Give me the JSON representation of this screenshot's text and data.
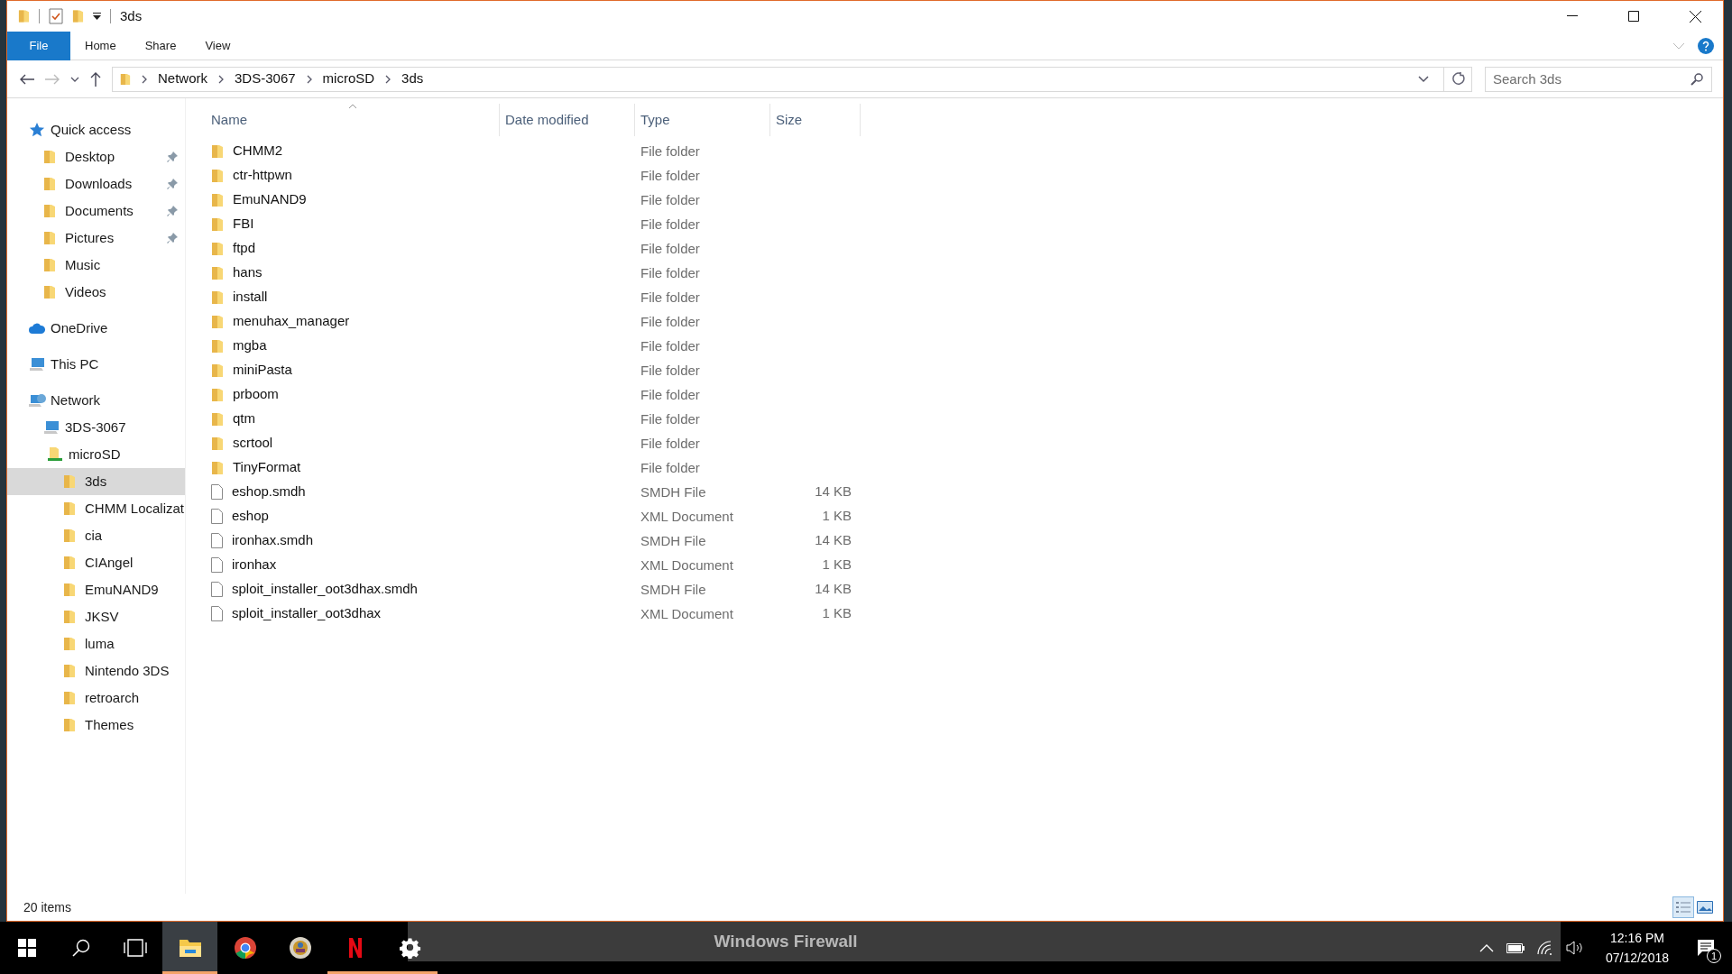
{
  "window": {
    "title": "3ds"
  },
  "ribbon_tabs": [
    {
      "label": "File",
      "kind": "file_menu"
    },
    {
      "label": "Home",
      "kind": "tab"
    },
    {
      "label": "Share",
      "kind": "tab"
    },
    {
      "label": "View",
      "kind": "tab"
    }
  ],
  "breadcrumbs": [
    "Network",
    "3DS-3067",
    "microSD",
    "3ds"
  ],
  "search": {
    "placeholder": "Search 3ds"
  },
  "sidebar": [
    {
      "label": "Quick access",
      "kind": "star",
      "selected": false,
      "children": [
        {
          "label": "Desktop",
          "kind": "folder",
          "pinned": true,
          "selected": false
        },
        {
          "label": "Downloads",
          "kind": "folder",
          "pinned": true,
          "selected": false
        },
        {
          "label": "Documents",
          "kind": "folder",
          "pinned": true,
          "selected": false
        },
        {
          "label": "Pictures",
          "kind": "folder",
          "pinned": true,
          "selected": false
        },
        {
          "label": "Music",
          "kind": "folder",
          "pinned": false,
          "selected": false
        },
        {
          "label": "Videos",
          "kind": "folder",
          "pinned": false,
          "selected": false
        }
      ]
    },
    {
      "label": "OneDrive",
      "kind": "cloud",
      "selected": false
    },
    {
      "label": "This PC",
      "kind": "computer",
      "selected": false
    },
    {
      "label": "Network",
      "kind": "network",
      "selected": false,
      "children": [
        {
          "label": "3DS-3067",
          "kind": "computer",
          "selected": false,
          "children": [
            {
              "label": "microSD",
              "kind": "share",
              "selected": false,
              "children": [
                {
                  "label": "3ds",
                  "kind": "folder",
                  "selected": true
                },
                {
                  "label": "CHMM Localizat",
                  "kind": "folder",
                  "selected": false
                },
                {
                  "label": "cia",
                  "kind": "folder",
                  "selected": false
                },
                {
                  "label": "CIAngel",
                  "kind": "folder",
                  "selected": false
                },
                {
                  "label": "EmuNAND9",
                  "kind": "folder",
                  "selected": false
                },
                {
                  "label": "JKSV",
                  "kind": "folder",
                  "selected": false
                },
                {
                  "label": "luma",
                  "kind": "folder",
                  "selected": false
                },
                {
                  "label": "Nintendo 3DS",
                  "kind": "folder",
                  "selected": false
                },
                {
                  "label": "retroarch",
                  "kind": "folder",
                  "selected": false
                },
                {
                  "label": "Themes",
                  "kind": "folder",
                  "selected": false
                }
              ]
            }
          ]
        }
      ]
    }
  ],
  "columns": [
    "Name",
    "Date modified",
    "Type",
    "Size"
  ],
  "rows": [
    {
      "name": "CHMM2",
      "kind": "folder",
      "type": "File folder"
    },
    {
      "name": "ctr-httpwn",
      "kind": "folder",
      "type": "File folder"
    },
    {
      "name": "EmuNAND9",
      "kind": "folder",
      "type": "File folder"
    },
    {
      "name": "FBI",
      "kind": "folder",
      "type": "File folder"
    },
    {
      "name": "ftpd",
      "kind": "folder",
      "type": "File folder"
    },
    {
      "name": "hans",
      "kind": "folder",
      "type": "File folder"
    },
    {
      "name": "install",
      "kind": "folder",
      "type": "File folder"
    },
    {
      "name": "menuhax_manager",
      "kind": "folder",
      "type": "File folder"
    },
    {
      "name": "mgba",
      "kind": "folder",
      "type": "File folder"
    },
    {
      "name": "miniPasta",
      "kind": "folder",
      "type": "File folder"
    },
    {
      "name": "prboom",
      "kind": "folder",
      "type": "File folder"
    },
    {
      "name": "qtm",
      "kind": "folder",
      "type": "File folder"
    },
    {
      "name": "scrtool",
      "kind": "folder",
      "type": "File folder"
    },
    {
      "name": "TinyFormat",
      "kind": "folder",
      "type": "File folder"
    },
    {
      "name": "eshop.smdh",
      "kind": "file",
      "type": "SMDH File",
      "size": "14 KB"
    },
    {
      "name": "eshop",
      "kind": "file",
      "type": "XML Document",
      "size": "1 KB"
    },
    {
      "name": "ironhax.smdh",
      "kind": "file",
      "type": "SMDH File",
      "size": "14 KB"
    },
    {
      "name": "ironhax",
      "kind": "file",
      "type": "XML Document",
      "size": "1 KB"
    },
    {
      "name": "sploit_installer_oot3dhax.smdh",
      "kind": "file",
      "type": "SMDH File",
      "size": "14 KB"
    },
    {
      "name": "sploit_installer_oot3dhax",
      "kind": "file",
      "type": "XML Document",
      "size": "1 KB"
    }
  ],
  "status_bar": {
    "count": "20 items",
    "views": [
      {
        "kind": "details",
        "selected": true
      },
      {
        "kind": "large_icons",
        "selected": false
      }
    ]
  },
  "background_window": {
    "title": "Windows Firewall"
  },
  "taskbar": {
    "apps": [
      {
        "kind": "explorer",
        "active": true,
        "running": true
      },
      {
        "kind": "browser",
        "active": false,
        "running": false
      },
      {
        "kind": "badge",
        "active": false,
        "running": false
      },
      {
        "kind": "letter",
        "active": false,
        "running": true
      },
      {
        "kind": "settings",
        "active": false,
        "running": true
      }
    ],
    "time": "12:16 PM",
    "date": "07/12/2018",
    "notifications": "1"
  }
}
